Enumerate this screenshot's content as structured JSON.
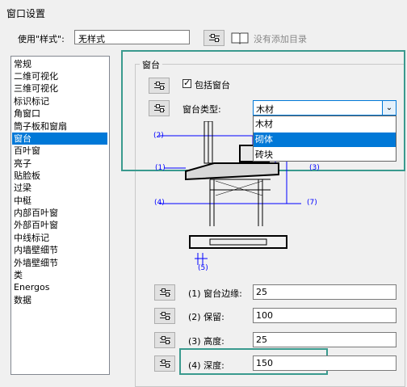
{
  "dialog": {
    "title": "窗口设置"
  },
  "style": {
    "label": "使用\"样式\":",
    "value": "无样式",
    "toc_label": "没有添加目录"
  },
  "categories": {
    "items": [
      "常规",
      "二维可视化",
      "三维可视化",
      "标识标记",
      "角窗口",
      "筒子板和窗扇",
      "窗台",
      "百叶窗",
      "亮子",
      "贴脸板",
      "过梁",
      "中梃",
      "内部百叶窗",
      "外部百叶窗",
      "中线标记",
      "内墙壁细节",
      "外墙壁细节",
      "类",
      "Energos",
      "数据"
    ],
    "selected_index": 6
  },
  "sill": {
    "group_label": "窗台",
    "include_label": "包括窗台",
    "include_checked": true,
    "type_label": "窗台类型:",
    "type_value": "木材",
    "type_options": [
      "木材",
      "砌体",
      "砖块"
    ],
    "highlighted_option": 1
  },
  "diagram": {
    "labels": [
      "(2)",
      "(1)",
      "(3)",
      "(4)",
      "(7)",
      "(5)"
    ]
  },
  "params": [
    {
      "label": "(1) 窗台边缘:",
      "value": "25"
    },
    {
      "label": "(2) 保留:",
      "value": "100"
    },
    {
      "label": "(3) 高度:",
      "value": "25"
    },
    {
      "label": "(4) 深度:",
      "value": "150"
    }
  ],
  "colors": {
    "accent": "#3a9a8e",
    "selection": "#0078d7"
  }
}
